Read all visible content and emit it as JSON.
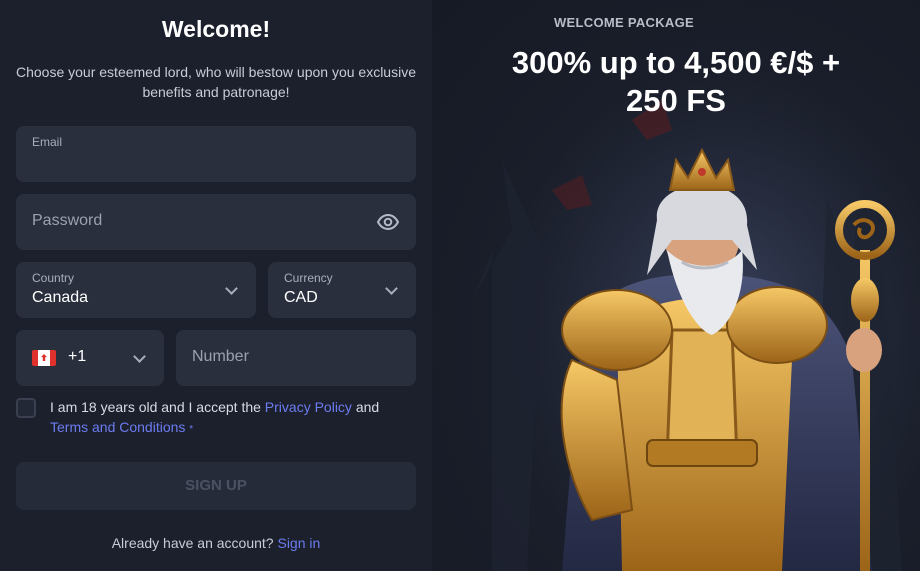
{
  "form": {
    "title": "Welcome!",
    "subtitle": "Choose your esteemed lord, who will bestow upon you exclusive benefits and patronage!",
    "email": {
      "label": "Email",
      "value": ""
    },
    "password": {
      "placeholder": "Password"
    },
    "country": {
      "label": "Country",
      "value": "Canada"
    },
    "currency": {
      "label": "Currency",
      "value": "CAD"
    },
    "phone": {
      "country_code": "+1",
      "placeholder": "Number"
    },
    "terms": {
      "prefix": "I am 18 years old and I accept the ",
      "privacy_link": "Privacy Policy",
      "middle": " and",
      "terms_link": "Terms and Conditions",
      "required_mark": "*"
    },
    "signup_button": "SIGN UP",
    "signin": {
      "prompt": "Already have an account?",
      "link": "Sign in"
    }
  },
  "promo": {
    "label": "WELCOME PACKAGE",
    "offer_line1": "300% up to 4,500 €/$ +",
    "offer_line2": "250 FS"
  },
  "colors": {
    "background": "#1c202c",
    "field": "#2a2f3e",
    "link": "#6b7cf0",
    "disabled_button": "#262b39",
    "gold": "#d9a23c"
  },
  "icons": [
    "eye-icon",
    "chevron-down-icon",
    "canada-flag-icon",
    "king-illustration"
  ]
}
